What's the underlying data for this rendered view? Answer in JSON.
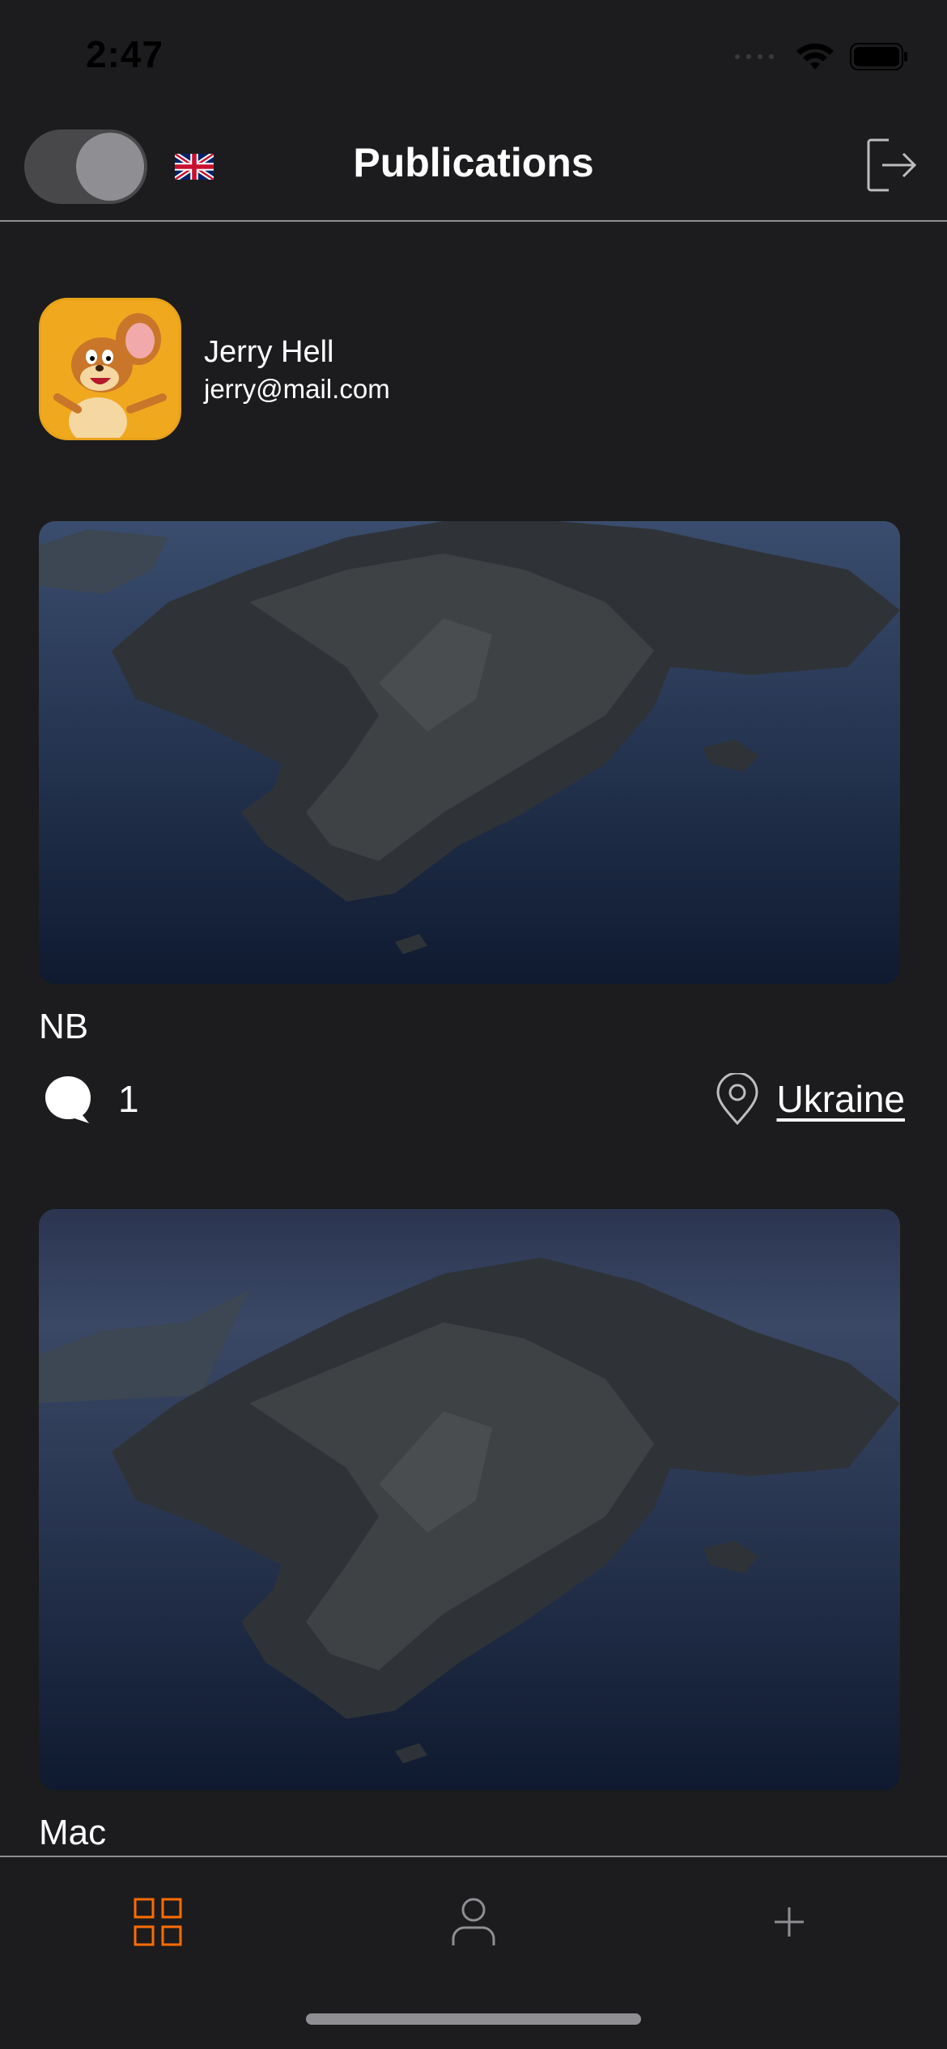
{
  "status_bar": {
    "time": "2:47"
  },
  "header": {
    "title": "Publications",
    "theme_toggle_on": true,
    "language_flag": "uk-flag-icon",
    "logout_icon": "logout-icon"
  },
  "profile": {
    "name": "Jerry Hell",
    "email": "jerry@mail.com"
  },
  "posts": [
    {
      "title": "NB",
      "comments_count": "1",
      "location": "Ukraine"
    },
    {
      "title": "Mac"
    }
  ],
  "tab_bar": {
    "items": [
      {
        "icon": "grid-icon",
        "active": true
      },
      {
        "icon": "user-icon",
        "active": false
      },
      {
        "icon": "plus-icon",
        "active": false
      }
    ],
    "active_color": "#ff6c00",
    "inactive_color": "#8e8e93"
  },
  "colors": {
    "background": "#1c1c1e",
    "accent": "#ff6c00"
  }
}
